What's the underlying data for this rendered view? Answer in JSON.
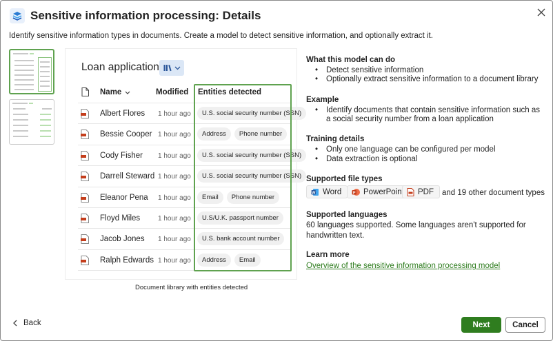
{
  "dialog": {
    "title": "Sensitive information processing: Details",
    "subtitle": "Identify sensitive information types in documents. Create a model to detect sensitive information, and optionally extract it.",
    "app_icon": "layers-icon",
    "close_icon": "close-icon"
  },
  "thumbnails": [
    {
      "name": "thumbnail-loan-application",
      "selected": true,
      "title": "Loan application"
    },
    {
      "name": "thumbnail-loan-application-extracted",
      "selected": false,
      "title": "Loan application"
    }
  ],
  "preview": {
    "title": "Loan application",
    "view_button_icon": "library-icon",
    "columns": {
      "name": "Name",
      "modified": "Modified",
      "entities": "Entities detected"
    },
    "rows": [
      {
        "name": "Albert Flores",
        "modified": "1 hour ago",
        "entities": [
          "U.S. social security number (SSN)"
        ]
      },
      {
        "name": "Bessie Cooper",
        "modified": "1 hour ago",
        "entities": [
          "Address",
          "Phone number"
        ]
      },
      {
        "name": "Cody Fisher",
        "modified": "1 hour ago",
        "entities": [
          "U.S. social security number (SSN)"
        ]
      },
      {
        "name": "Darrell Steward",
        "modified": "1 hour ago",
        "entities": [
          "U.S. social security number (SSN)"
        ]
      },
      {
        "name": "Eleanor Pena",
        "modified": "1 hour ago",
        "entities": [
          "Email",
          "Phone number"
        ]
      },
      {
        "name": "Floyd Miles",
        "modified": "1 hour ago",
        "entities": [
          "U.S/U.K. passport number"
        ]
      },
      {
        "name": "Jacob Jones",
        "modified": "1 hour ago",
        "entities": [
          "U.S. bank account number"
        ]
      },
      {
        "name": "Ralph Edwards",
        "modified": "1 hour ago",
        "entities": [
          "Address",
          "Email"
        ]
      }
    ],
    "caption": "Document library with entities detected",
    "accent_color": "#5fa24f"
  },
  "details": {
    "what_heading": "What this model can do",
    "what_items": [
      "Detect sensitive information",
      "Optionally extract sensitive information to a document library"
    ],
    "example_heading": "Example",
    "example_items": [
      "Identify documents that contain sensitive information such as a social security number from a loan application"
    ],
    "training_heading": "Training details",
    "training_items": [
      "Only one language can be configured per model",
      "Data extraction is optional"
    ],
    "file_types_heading": "Supported file types",
    "file_types": [
      {
        "label": "Word",
        "icon": "word-icon",
        "color": "#2b579a"
      },
      {
        "label": "PowerPoint",
        "icon": "powerpoint-icon",
        "color": "#d24726"
      },
      {
        "label": "PDF",
        "icon": "pdf-icon",
        "color": "#c43e1c"
      }
    ],
    "file_types_more": "and 19 other document types",
    "languages_heading": "Supported languages",
    "languages_text": "60 languages supported. Some languages aren't supported for handwritten text.",
    "learn_heading": "Learn more",
    "learn_link": "Overview of the sensitive information processing model"
  },
  "footer": {
    "back_label": "Back",
    "next_label": "Next",
    "cancel_label": "Cancel",
    "primary_color": "#2f7d1f"
  }
}
